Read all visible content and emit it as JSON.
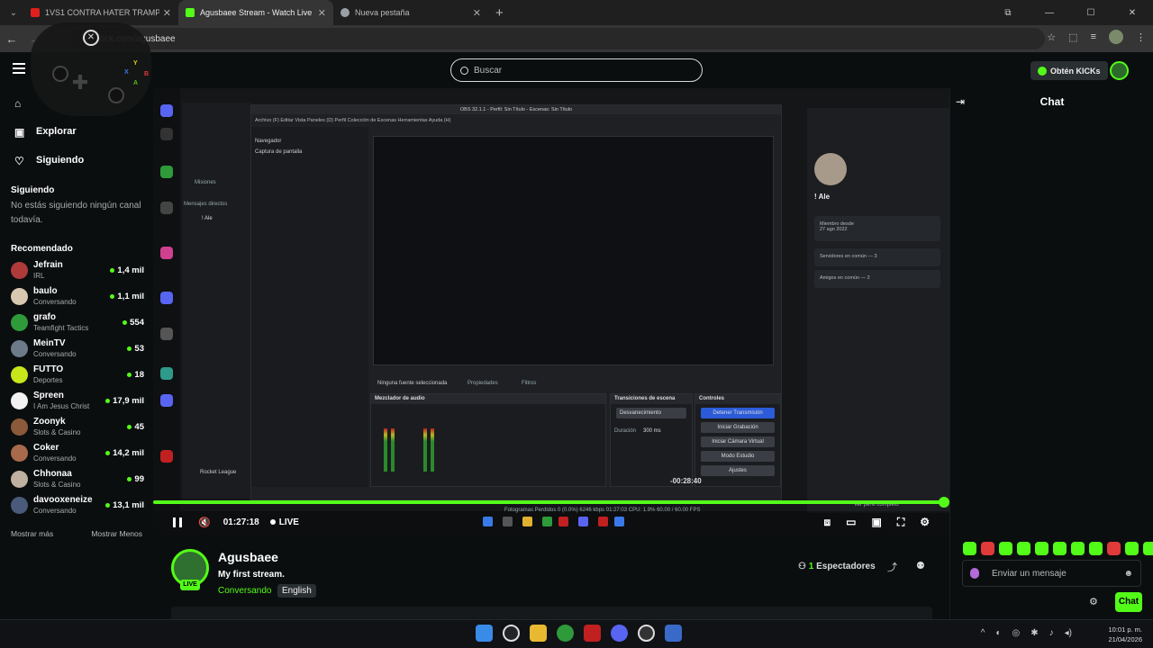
{
  "browser": {
    "tabs": [
      {
        "label": "1VS1 CONTRA HATER TRAMPO",
        "active": false,
        "favicon_color": "#e01f1f"
      },
      {
        "label": "Agusbaee Stream - Watch Live",
        "active": true,
        "favicon_color": "#53fc18"
      },
      {
        "label": "Nueva pestaña",
        "active": false,
        "favicon_color": "#9aa0a6"
      }
    ],
    "url": "kick.com/agusbaee"
  },
  "header": {
    "search_placeholder": "Buscar",
    "get_kicks_label": "Obtén KICKs"
  },
  "sidebar": {
    "nav": [
      {
        "label": "",
        "icon": "home-icon"
      },
      {
        "label": "Explorar",
        "icon": "browse-icon"
      },
      {
        "label": "Siguiendo",
        "icon": "heart-icon"
      }
    ],
    "following_title": "Siguiendo",
    "following_empty": "No estás siguiendo ningún canal todavía.",
    "recommended_title": "Recomendado",
    "recommended": [
      {
        "name": "Jefrain",
        "category": "IRL",
        "viewers": "1,4 mil",
        "avatar_color": "#b03a3a"
      },
      {
        "name": "baulo",
        "category": "Conversando",
        "viewers": "1,1 mil",
        "avatar_color": "#d8c8b0"
      },
      {
        "name": "grafo",
        "category": "Teamfight Tactics",
        "viewers": "554",
        "avatar_color": "#2e9a3a"
      },
      {
        "name": "MeinTV",
        "category": "Conversando",
        "viewers": "53",
        "avatar_color": "#6c7a8a"
      },
      {
        "name": "FUTTO",
        "category": "Deportes",
        "viewers": "18",
        "avatar_color": "#c8e61a"
      },
      {
        "name": "Spreen",
        "category": "I Am Jesus Christ",
        "viewers": "17,9 mil",
        "avatar_color": "#f2f2f2"
      },
      {
        "name": "Zoonyk",
        "category": "Slots & Casino",
        "viewers": "45",
        "avatar_color": "#8a5a3a"
      },
      {
        "name": "Coker",
        "category": "Conversando",
        "viewers": "14,2 mil",
        "avatar_color": "#a86a4a"
      },
      {
        "name": "Chhonaa",
        "category": "Slots & Casino",
        "viewers": "99",
        "avatar_color": "#c0b0a0"
      },
      {
        "name": "davooxeneize",
        "category": "Conversando",
        "viewers": "13,1 mil",
        "avatar_color": "#4a5a7a"
      }
    ],
    "show_more": "Mostrar más",
    "show_less": "Mostrar Menos"
  },
  "video": {
    "elapsed": "01:27:18",
    "live_label": "LIVE",
    "overlay_timer": "-00:28:40",
    "progress": 1.0,
    "obs": {
      "title": "OBS 32.1.1 - Perfil: Sin Título - Escenas: Sin Título",
      "menu": "Archivo (F)  Editar  Vista  Paneles (D)  Perfil  Colección de Escenas  Herramientas  Ayuda (H)",
      "sources": [
        "Navegador",
        "Captura de pantalla"
      ],
      "no_source": "Ninguna fuente seleccionada",
      "properties": "Propiedades",
      "filters": "Filtros",
      "mixer_title": "Mezclador de audio",
      "transitions_title": "Transiciones de escena",
      "transition_value": "Desvanecimiento",
      "duration_label": "Duración",
      "duration_value": "300 ms",
      "controls_title": "Controles",
      "controls": [
        "Detener Transmisión",
        "Iniciar Grabación",
        "Iniciar Cámara Virtual",
        "Modo Estudio",
        "Ajustes"
      ],
      "status": "Fotogramas Perdidos 0 (0.0%)   6246 kbps   01:27:03   CPU: 1.9%   60.00 / 60.00 FPS"
    },
    "discord": {
      "dm_title": "Mensajes directos",
      "missions": "Misiones",
      "dm_user": "! Ale",
      "profile_name": "! Ale",
      "member_since_label": "Miembro desde",
      "member_since": "27 ago 2022",
      "mutual_servers": "Servidores en común — 3",
      "mutual_friends": "Amigos en común — 2",
      "game": "Rocket League",
      "full_profile": "Ver perfil completo"
    }
  },
  "stream": {
    "name": "Agusbaee",
    "title": "My first stream.",
    "category": "Conversando",
    "language": "English",
    "viewers": "1",
    "viewers_label": "Espectadores",
    "live_badge": "LIVE"
  },
  "chat": {
    "title": "Chat",
    "input_placeholder": "Enviar un mensaje",
    "send_label": "Chat",
    "emote_colors": [
      "#53fc18",
      "#e03a3a",
      "#53fc18",
      "#53fc18",
      "#53fc18",
      "#53fc18",
      "#53fc18",
      "#53fc18",
      "#e03a3a",
      "#53fc18",
      "#53fc18"
    ]
  },
  "taskbar": {
    "time": "10:01 p. m.",
    "date": "21/04/2026"
  },
  "colors": {
    "accent": "#53fc18",
    "background": "#0b0e0f"
  }
}
